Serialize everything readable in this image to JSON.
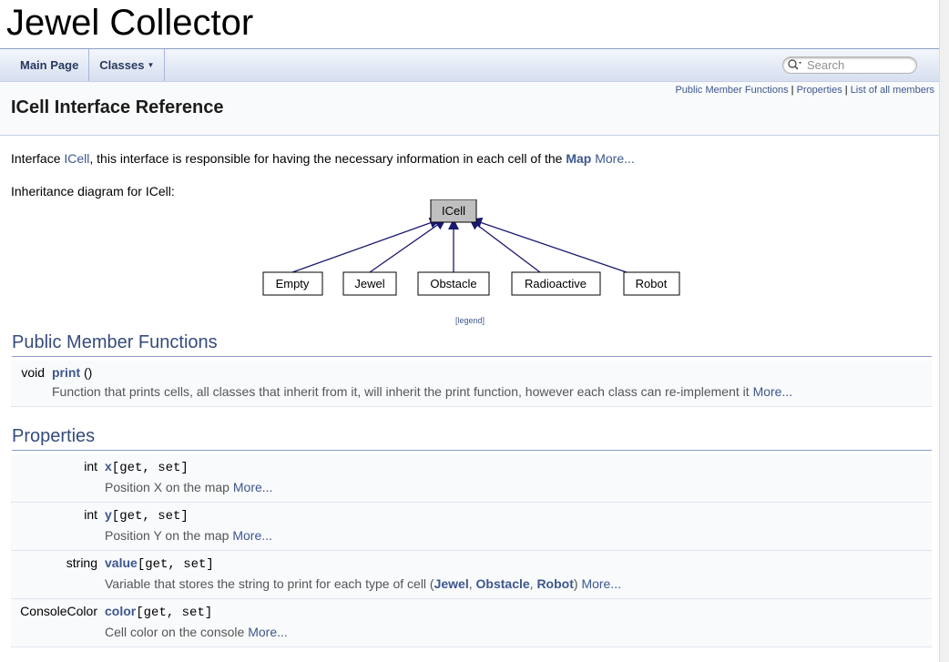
{
  "project": {
    "title": "Jewel Collector"
  },
  "navbar": {
    "main_page": "Main Page",
    "classes": "Classes",
    "search_placeholder": "Search"
  },
  "header": {
    "links": [
      "Public Member Functions",
      "Properties",
      "List of all members"
    ],
    "separator": "|",
    "title": "ICell Interface Reference"
  },
  "brief": {
    "prefix": "Interface ",
    "class_link": "ICell",
    "middle": ", this interface is responsible for having the necessary information in each cell of the ",
    "map_link": "Map",
    "more": "More..."
  },
  "inheritance": {
    "label": "Inheritance diagram for ICell:",
    "base": "ICell",
    "children": [
      "Empty",
      "Jewel",
      "Obstacle",
      "Radioactive",
      "Robot"
    ],
    "legend": "[legend]"
  },
  "public_functions": {
    "heading": "Public Member Functions",
    "items": [
      {
        "type": "void",
        "name": "print",
        "args": " ()",
        "desc": "Function that prints cells, all classes that inherit from it, will inherit the print function, however each class can re-implement it ",
        "more": "More..."
      }
    ]
  },
  "properties": {
    "heading": "Properties",
    "accessors": "[get, set]",
    "items": [
      {
        "type": "int",
        "name": "x",
        "desc": "Position X on the map ",
        "more": "More..."
      },
      {
        "type": "int",
        "name": "y",
        "desc": "Position Y on the map ",
        "more": "More..."
      },
      {
        "type": "string",
        "name": "value",
        "desc": "Variable that stores the string to print for each type of cell (",
        "refs": [
          "Jewel",
          "Obstacle",
          "Robot"
        ],
        "ref_sep": ", ",
        "desc_end": ") ",
        "more": "More..."
      },
      {
        "type": "ConsoleColor",
        "name": "color",
        "desc": "Cell color on the console ",
        "more": "More..."
      }
    ]
  }
}
